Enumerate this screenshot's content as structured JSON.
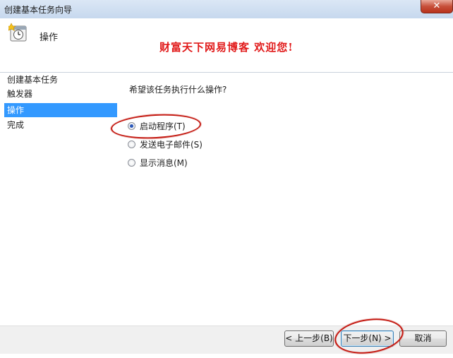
{
  "window": {
    "title": "创建基本任务向导",
    "close_label": "✕"
  },
  "header": {
    "title": "操作",
    "watermark": "财富天下网易博客 欢迎您!"
  },
  "sidebar": {
    "items": [
      {
        "label": "创建基本任务"
      },
      {
        "label": "触发器"
      },
      {
        "label": "操作",
        "active": true
      },
      {
        "label": "完成"
      }
    ]
  },
  "main": {
    "question": "希望该任务执行什么操作?",
    "options": [
      {
        "label": "启动程序(T)",
        "checked": true
      },
      {
        "label": "发送电子邮件(S)",
        "checked": false
      },
      {
        "label": "显示消息(M)",
        "checked": false
      }
    ]
  },
  "footer": {
    "back_label": "< 上一步(B)",
    "next_label": "下一步(N) >",
    "cancel_label": "取消"
  },
  "colors": {
    "accent": "#3399ff",
    "annotation": "#c41a12",
    "watermark": "#e11a1a"
  }
}
